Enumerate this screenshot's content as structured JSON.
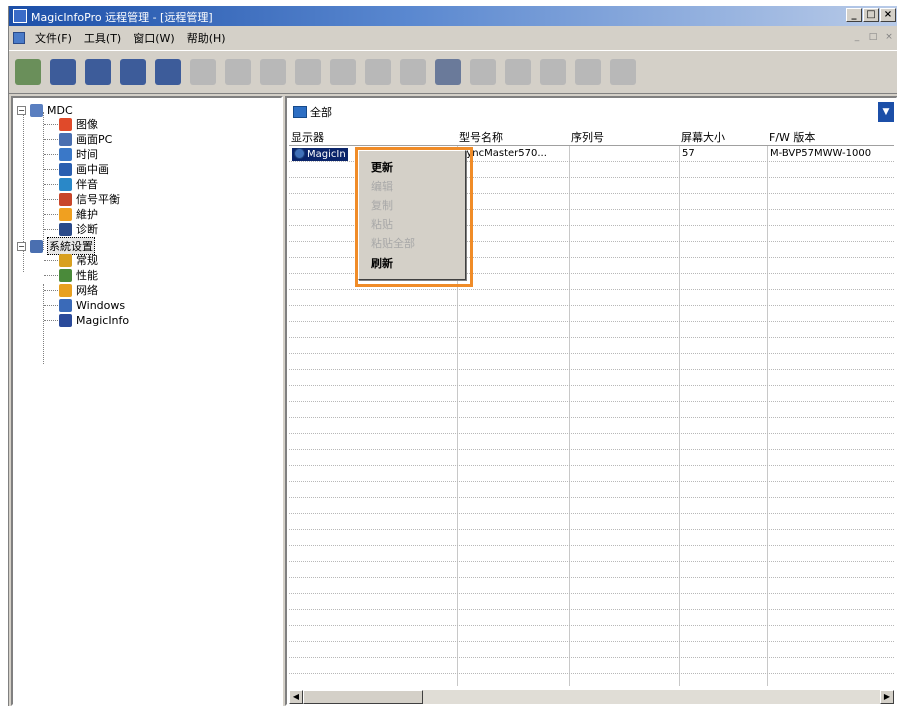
{
  "window": {
    "title": "MagicInfoPro 远程管理 - [远程管理]",
    "buttons": [
      "_",
      "□",
      "×"
    ]
  },
  "menubar": {
    "items": [
      "文件(F)",
      "工具(T)",
      "窗口(W)",
      "帮助(H)"
    ],
    "mdi_buttons": [
      "_",
      "□",
      "×"
    ]
  },
  "toolbar": {
    "buttons": [
      {
        "name": "mdc-display-tool",
        "color": "#6a8f5a",
        "state": "active"
      },
      {
        "name": "monitor-tool",
        "color": "#3d5c9a",
        "state": "active"
      },
      {
        "name": "clock-tool",
        "color": "#3d5c9a",
        "state": "active"
      },
      {
        "name": "settings-tool",
        "color": "#3d5c9a",
        "state": "active"
      },
      {
        "name": "text-tool",
        "color": "#3d5c9a",
        "state": "active"
      },
      {
        "name": "image-tool",
        "color": "#b8b8b8",
        "state": "disabled"
      },
      {
        "name": "save-tool",
        "color": "#b8b8b8",
        "state": "disabled"
      },
      {
        "name": "preview-tool",
        "color": "#b8b8b8",
        "state": "disabled"
      },
      {
        "name": "add-device-tool",
        "color": "#b8b8b8",
        "state": "disabled"
      },
      {
        "name": "copy-device-tool",
        "color": "#b8b8b8",
        "state": "disabled"
      },
      {
        "name": "connect-tool",
        "color": "#b8b8b8",
        "state": "disabled"
      },
      {
        "name": "delete-tool",
        "color": "#b8b8b8",
        "state": "disabled"
      },
      {
        "name": "refresh-tool",
        "color": "#6a7a9a",
        "state": "active"
      },
      {
        "name": "schedule-tool",
        "color": "#b8b8b8",
        "state": "disabled"
      },
      {
        "name": "schedule2-tool",
        "color": "#b8b8b8",
        "state": "disabled"
      },
      {
        "name": "undo-tool",
        "color": "#b8b8b8",
        "state": "disabled"
      },
      {
        "name": "redo-tool",
        "color": "#b8b8b8",
        "state": "disabled"
      },
      {
        "name": "info-tool",
        "color": "#b8b8b8",
        "state": "disabled"
      }
    ]
  },
  "tree": {
    "root_mdc": "MDC",
    "mdc_children": [
      "图像",
      "画面PC",
      "时间",
      "画中画",
      "伴音",
      "信号平衡",
      "維护",
      "诊断"
    ],
    "root_system": "系統设置",
    "system_children": [
      "常规",
      "性能",
      "网络",
      "Windows",
      "MagicInfo"
    ],
    "icon_colors": {
      "图像": "#e04a2a",
      "画面PC": "#4a6fb0",
      "时间": "#3a78c8",
      "画中画": "#2a5fb0",
      "伴音": "#2a88c8",
      "信号平衡": "#c8462a",
      "維护": "#f0a020",
      "诊断": "#2a4a8a",
      "常规": "#d8a020",
      "性能": "#4a8a3a",
      "网络": "#e8a020",
      "Windows": "#3a6ab8",
      "MagicInfo": "#2a4a9a"
    }
  },
  "right": {
    "group_selector": "全部",
    "columns": [
      "显示器",
      "型号名称",
      "序列号",
      "屏幕大小",
      "F/W 版本"
    ],
    "rows": [
      {
        "display": "MagicIn",
        "model": "SyncMaster570...",
        "serial": "",
        "size": "57",
        "fw": "M-BVP57MWW-1000"
      }
    ]
  },
  "context_menu": {
    "items": [
      {
        "label": "更新",
        "enabled": true
      },
      {
        "label": "编辑",
        "enabled": false
      },
      {
        "label": "复制",
        "enabled": false
      },
      {
        "label": "粘贴",
        "enabled": false
      },
      {
        "label": "粘贴全部",
        "enabled": false
      },
      {
        "label": "刷新",
        "enabled": true
      }
    ]
  },
  "colors": {
    "title_bar": "#1c4fa8",
    "selection": "#0a246a",
    "highlight_box": "#f08c28",
    "face": "#d4d0c8"
  }
}
